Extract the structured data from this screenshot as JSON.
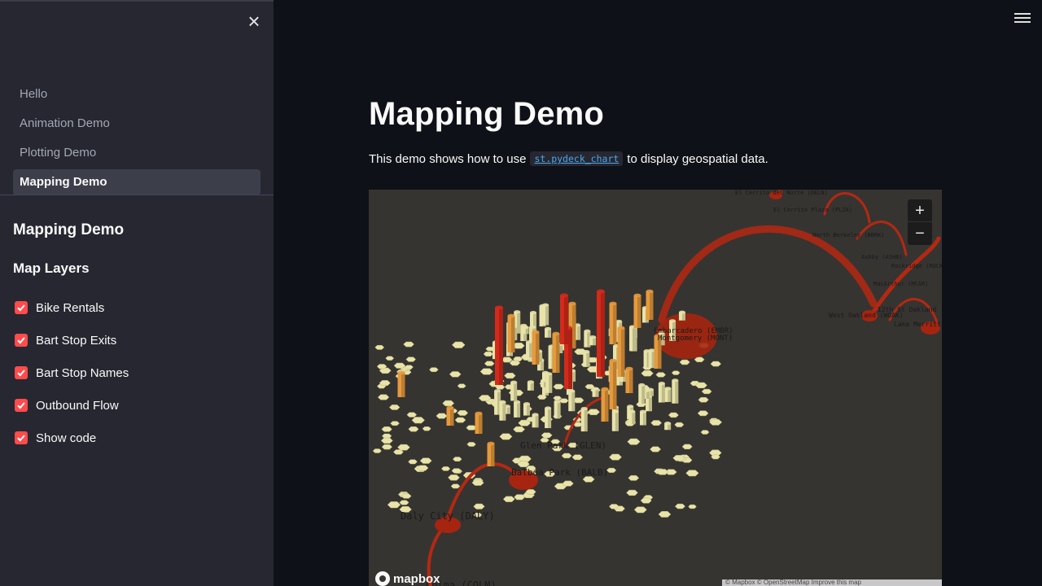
{
  "sidebar": {
    "close_icon": "close-icon",
    "nav": [
      {
        "label": "Hello",
        "active": false
      },
      {
        "label": "Animation Demo",
        "active": false
      },
      {
        "label": "Plotting Demo",
        "active": false
      },
      {
        "label": "Mapping Demo",
        "active": true
      }
    ],
    "heading": "Mapping Demo",
    "subheading": "Map Layers",
    "checkboxes": [
      {
        "label": "Bike Rentals",
        "checked": true
      },
      {
        "label": "Bart Stop Exits",
        "checked": true
      },
      {
        "label": "Bart Stop Names",
        "checked": true
      },
      {
        "label": "Outbound Flow",
        "checked": true
      },
      {
        "label": "Show code",
        "checked": true
      }
    ]
  },
  "main": {
    "menu_icon": "hamburger-menu-icon",
    "title": "Mapping Demo",
    "description_before": "This demo shows how to use",
    "code_link": "st.pydeck_chart",
    "description_after": "to display geospatial data."
  },
  "map": {
    "zoom_in": "+",
    "zoom_out": "−",
    "logo": "mapbox",
    "attribution": "© Mapbox © OpenStreetMap Improve this map",
    "stop_labels": [
      {
        "text": "El Cerrito del Norte (DELN)"
      },
      {
        "text": "El Cerrito Plaza (PLZA)"
      },
      {
        "text": "North Berkeley (NBRK)"
      },
      {
        "text": "Ashby (ASHB)"
      },
      {
        "text": "Rockridge (ROCK)"
      },
      {
        "text": "MacArthur (MCAR)"
      },
      {
        "text": "West Oakland (WOAK)"
      },
      {
        "text": "12th St Oakland"
      },
      {
        "text": "Lake Merritt"
      },
      {
        "text": "Embarcadero (EMBR)"
      },
      {
        "text": "Montgomery (MONT)"
      },
      {
        "text": "Glen Park (GLEN)"
      },
      {
        "text": "Balboa Park (BALB)"
      },
      {
        "text": "Daly City (DALY)"
      },
      {
        "text": "Colma (COLM)"
      }
    ],
    "colors": {
      "background": "#363431",
      "hex_light": "#e8e3a8",
      "hex_orange": "#e69a3c",
      "column_red": "#d42a1a",
      "arc": "#b42812"
    }
  }
}
